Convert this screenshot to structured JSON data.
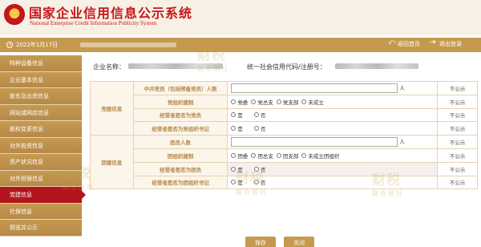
{
  "header": {
    "title": "国家企业信用信息公示系统",
    "subtitle": "National Enterprise Credit Information Publicity System"
  },
  "toolbar": {
    "date": "2022年1月17日",
    "back_label": "返回首页",
    "logout_label": "退出登录"
  },
  "sidebar": {
    "items": [
      {
        "label": "特种设备信息"
      },
      {
        "label": "企业基本信息"
      },
      {
        "label": "股东及出资信息"
      },
      {
        "label": "网站或网店信息"
      },
      {
        "label": "股权变更信息"
      },
      {
        "label": "对外投资信息"
      },
      {
        "label": "资产状况信息"
      },
      {
        "label": "对外担保信息"
      },
      {
        "label": "党建信息"
      },
      {
        "label": "社保信息"
      },
      {
        "label": "预览并公示"
      }
    ],
    "active_index": 8
  },
  "company": {
    "name_label": "企业名称：",
    "code_label": "统一社会信用代码/注册号："
  },
  "form": {
    "party_group": "党建信息",
    "league_group": "团建信息",
    "rows": [
      {
        "label": "中共党员（包括预备党员）人数",
        "type": "input",
        "unit": "人",
        "status": "不公示"
      },
      {
        "label": "党组织建制",
        "type": "radio",
        "options": [
          "党委",
          "党总支",
          "党支部",
          "未成立"
        ],
        "status": "不公示"
      },
      {
        "label": "经营者是否为党员",
        "type": "yesno",
        "options": [
          "是",
          "否"
        ],
        "status": "不公示"
      },
      {
        "label": "经营者是否为党组织书记",
        "type": "yesno",
        "options": [
          "是",
          "否"
        ],
        "status": "不公示"
      },
      {
        "label": "团员人数",
        "type": "input",
        "unit": "人",
        "status": "不公示"
      },
      {
        "label": "团组织建制",
        "type": "radio",
        "options": [
          "团委",
          "团总支",
          "团支部",
          "未成立团组织"
        ],
        "status": "不公示"
      },
      {
        "label": "经营者是否为团员",
        "type": "yesno",
        "options": [
          "是",
          "否"
        ],
        "status": "不公示"
      },
      {
        "label": "经营者是否为团组织书记",
        "type": "yesno",
        "options": [
          "是",
          "否"
        ],
        "status": "不公示"
      }
    ]
  },
  "actions": {
    "save_label": "保存",
    "close_label": "关闭"
  },
  "watermark": {
    "brand": "财税",
    "tagline": "联合税社"
  },
  "colors": {
    "brand_red": "#c8161d",
    "gold": "#c59a4f",
    "active_sidebar": "#b3151c"
  }
}
